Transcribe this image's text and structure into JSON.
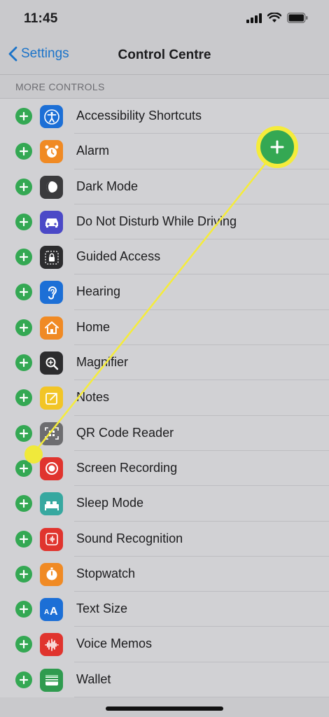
{
  "status": {
    "time": "11:45"
  },
  "nav": {
    "back_label": "Settings",
    "title": "Control Centre"
  },
  "section": {
    "header": "MORE CONTROLS"
  },
  "accent_color": "#1a73c9",
  "add_button_color": "#34a853",
  "highlight_color": "#f5ec3b",
  "controls": [
    {
      "label": "Accessibility Shortcuts",
      "icon": "accessibility-icon",
      "color": "#1c6fd6"
    },
    {
      "label": "Alarm",
      "icon": "alarm-clock-icon",
      "color": "#f08a24"
    },
    {
      "label": "Dark Mode",
      "icon": "dark-mode-icon",
      "color": "#3a3a3c"
    },
    {
      "label": "Do Not Disturb While Driving",
      "icon": "car-icon",
      "color": "#4b49c7"
    },
    {
      "label": "Guided Access",
      "icon": "lock-icon",
      "color": "#2c2c2e"
    },
    {
      "label": "Hearing",
      "icon": "ear-icon",
      "color": "#1c6fd6"
    },
    {
      "label": "Home",
      "icon": "house-icon",
      "color": "#f08a24"
    },
    {
      "label": "Magnifier",
      "icon": "magnifier-icon",
      "color": "#2c2c2e"
    },
    {
      "label": "Notes",
      "icon": "notes-icon",
      "color": "#f2c526"
    },
    {
      "label": "QR Code Reader",
      "icon": "qr-code-icon",
      "color": "#6d6d70"
    },
    {
      "label": "Screen Recording",
      "icon": "record-icon",
      "color": "#e0342e"
    },
    {
      "label": "Sleep Mode",
      "icon": "bed-icon",
      "color": "#37a8a0"
    },
    {
      "label": "Sound Recognition",
      "icon": "sound-recognition-icon",
      "color": "#e0342e"
    },
    {
      "label": "Stopwatch",
      "icon": "stopwatch-icon",
      "color": "#f08a24"
    },
    {
      "label": "Text Size",
      "icon": "text-size-icon",
      "color": "#1c6fd6"
    },
    {
      "label": "Voice Memos",
      "icon": "waveform-icon",
      "color": "#e0342e"
    },
    {
      "label": "Wallet",
      "icon": "wallet-icon",
      "color": "#2f9b4f"
    }
  ]
}
